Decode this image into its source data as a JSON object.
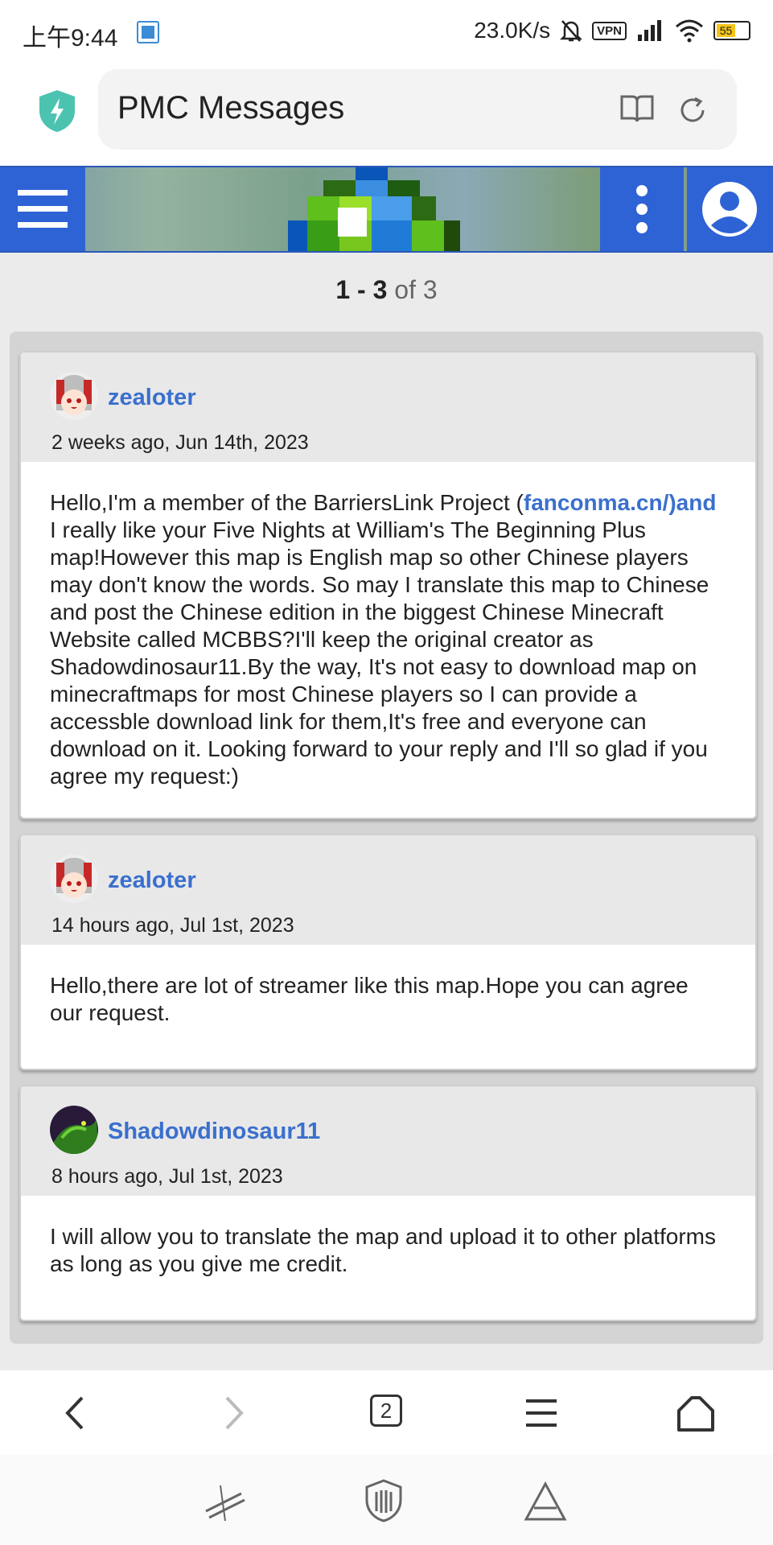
{
  "status_bar": {
    "time": "上午9:44",
    "network_speed": "23.0K/s",
    "vpn_label": "VPN",
    "battery": "55"
  },
  "browser": {
    "title": "PMC Messages",
    "tab_count": "2"
  },
  "header": {
    "accent_color": "#2e63d6",
    "icons": [
      "hamburger-menu-icon",
      "site-logo",
      "more-vertical-icon",
      "user-account-icon"
    ]
  },
  "pagination": {
    "range": "1 - 3",
    "of_label": "of 3"
  },
  "messages": [
    {
      "author": "zealoter",
      "time": "2 weeks ago, Jun 14th, 2023",
      "body_before": "Hello,I'm a member of the BarriersLink Project (",
      "link_text": "fanconma.cn/)and",
      "body_after": " I really like your Five Nights at William's The Beginning Plus map!However this map is English map so other Chinese players may don't know the words. So may I translate this map to Chinese and post the Chinese edition in the biggest Chinese Minecraft Website called MCBBS?I'll keep the original creator as Shadowdinosaur11.By the way, It's not easy to download map on minecraftmaps for most Chinese players so I can provide a accessble download link for them,It's free and everyone can download on it. Looking forward to your reply and I'll so glad if you agree my request:)"
    },
    {
      "author": "zealoter",
      "time": "14 hours ago, Jul 1st, 2023",
      "body": "Hello,there are lot of streamer like this map.Hope you can agree our request."
    },
    {
      "author": "Shadowdinosaur11",
      "time": "8 hours ago, Jul 1st, 2023",
      "body": "I will allow you to translate the map and upload it to other platforms as long as you give me credit."
    }
  ],
  "link_color": "#3a6fcd"
}
